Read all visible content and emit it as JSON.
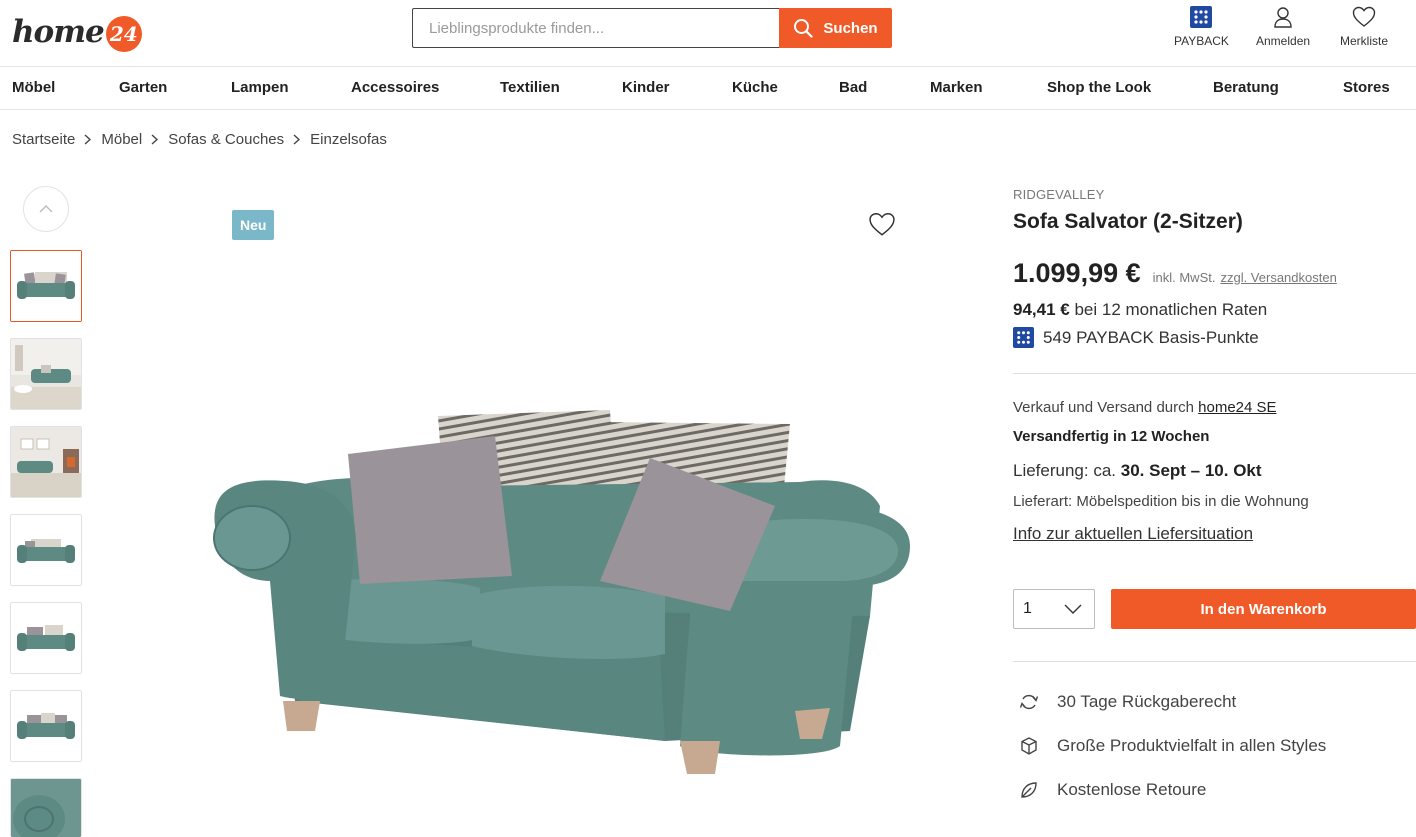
{
  "header": {
    "logo_text": "home",
    "logo_number": "24",
    "search_placeholder": "Lieblingsprodukte finden...",
    "search_button": "Suchen",
    "payback_label": "PAYBACK",
    "login_label": "Anmelden",
    "wishlist_label": "Merkliste"
  },
  "nav": {
    "items": [
      "Möbel",
      "Garten",
      "Lampen",
      "Accessoires",
      "Textilien",
      "Kinder",
      "Küche",
      "Bad",
      "Marken",
      "Shop the Look",
      "Beratung",
      "Stores"
    ]
  },
  "breadcrumb": [
    "Startseite",
    "Möbel",
    "Sofas & Couches",
    "Einzelsofas"
  ],
  "gallery": {
    "badge": "Neu",
    "thumbnail_count": 7
  },
  "product": {
    "brand": "RIDGEVALLEY",
    "title": "Sofa Salvator (2-Sitzer)",
    "price": "1.099,99 €",
    "tax_note": "inkl. MwSt.",
    "shipping_link": "zzgl. Versandkosten",
    "rate_amount": "94,41 €",
    "rate_text": " bei 12 monatlichen Raten",
    "payback_points": "549 PAYBACK Basis-Punkte",
    "seller_prefix": "Verkauf und Versand durch ",
    "seller_name": "home24 SE",
    "ready_text": "Versandfertig in 12 Wochen",
    "delivery_prefix": "Lieferung: ca. ",
    "delivery_dates": "30. Sept – 10. Okt",
    "delivery_type": "Lieferart: Möbelspedition bis in die Wohnung",
    "info_link": "Info zur aktuellen Liefersituation",
    "quantity": "1",
    "cart_button": "In den Warenkorb"
  },
  "features": [
    {
      "icon": "return-icon",
      "label": "30 Tage Rückgaberecht"
    },
    {
      "icon": "box-icon",
      "label": "Große Produktvielfalt in allen Styles"
    },
    {
      "icon": "leaf-icon",
      "label": "Kostenlose Retoure"
    }
  ],
  "colors": {
    "accent": "#f05a28",
    "badge": "#7ab8c9",
    "sofa": "#5e8a84",
    "payback_blue": "#1f4aa0"
  }
}
